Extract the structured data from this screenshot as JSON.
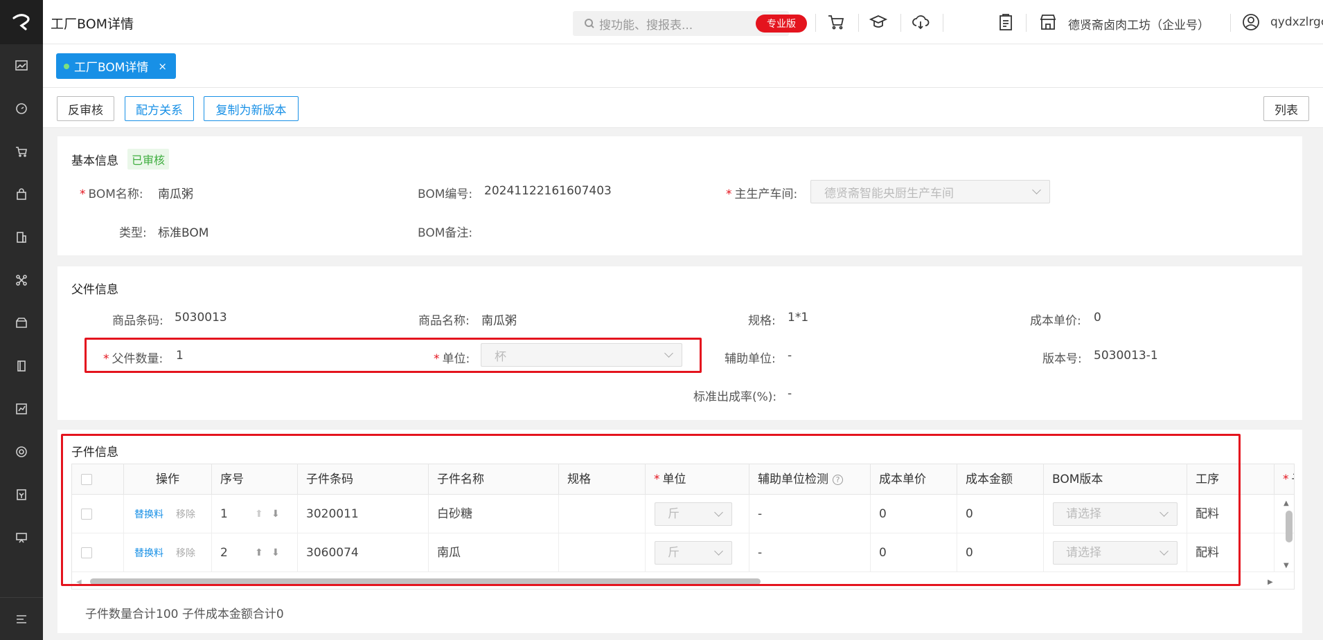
{
  "header": {
    "title": "工厂BOM详情",
    "search_placeholder": "搜功能、搜报表...",
    "badge": "专业版",
    "shop": "德贤斋卤肉工坊（企业号）",
    "user": "qydxzlrgc"
  },
  "tabs": [
    {
      "label": "工厂BOM详情",
      "close": "×"
    }
  ],
  "toolbar": {
    "unaudit": "反审核",
    "recipe_relation": "配方关系",
    "copy_new_version": "复制为新版本",
    "list": "列表"
  },
  "basic_info": {
    "title": "基本信息",
    "status": "已审核",
    "bom_name_label": "BOM名称:",
    "bom_name": "南瓜粥",
    "bom_code_label": "BOM编号:",
    "bom_code": "20241122161607403",
    "workshop_label": "主生产车间:",
    "workshop": "德贤斋智能央厨生产车间",
    "type_label": "类型:",
    "type": "标准BOM",
    "remark_label": "BOM备注:"
  },
  "parent_info": {
    "title": "父件信息",
    "barcode_label": "商品条码:",
    "barcode": "5030013",
    "name_label": "商品名称:",
    "name": "南瓜粥",
    "spec_label": "规格:",
    "spec": "1*1",
    "cost_label": "成本单价:",
    "cost": "0",
    "qty_label": "父件数量:",
    "qty": "1",
    "unit_label": "单位:",
    "unit": "杯",
    "aux_unit_label": "辅助单位:",
    "aux_unit": "-",
    "version_label": "版本号:",
    "version": "5030013-1",
    "yield_label": "标准出成率(%):",
    "yield": "-"
  },
  "child_info": {
    "title": "子件信息",
    "columns": [
      "操作",
      "序号",
      "子件条码",
      "子件名称",
      "规格",
      "单位",
      "辅助单位检测",
      "成本单价",
      "成本金额",
      "BOM版本",
      "工序",
      "子"
    ],
    "rows": [
      {
        "op_replace": "替换料",
        "op_remove": "移除",
        "seq": "1",
        "barcode": "3020011",
        "name": "白砂糖",
        "spec": "",
        "unit": "斤",
        "aux": "-",
        "cost": "0",
        "amount": "0",
        "bom_version": "请选择",
        "process": "配料"
      },
      {
        "op_replace": "替换料",
        "op_remove": "移除",
        "seq": "2",
        "barcode": "3060074",
        "name": "南瓜",
        "spec": "",
        "unit": "斤",
        "aux": "-",
        "cost": "0",
        "amount": "0",
        "bom_version": "请选择",
        "process": "配料"
      }
    ],
    "summary": "子件数量合计100 子件成本金额合计0"
  },
  "colors": {
    "accent": "#1890e6",
    "danger": "#e4141e",
    "sidebar": "#2b2b2b"
  }
}
